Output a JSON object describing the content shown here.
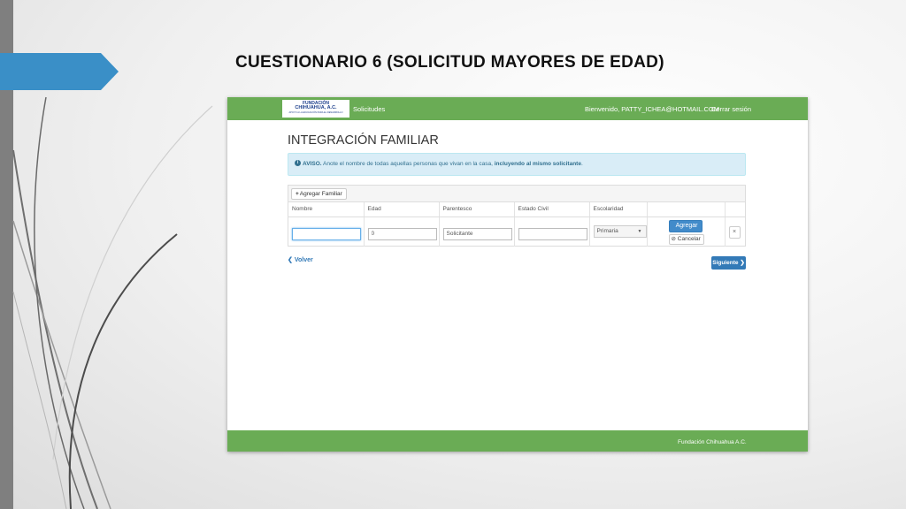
{
  "slide": {
    "title": "CUESTIONARIO 6 (SOLICITUD MAYORES DE EDAD)"
  },
  "navbar": {
    "logo_line1": "FUNDACIÓN",
    "logo_line2": "CHIHUAHUA, A.C.",
    "logo_line3": "APOYO A LA EDUCACIÓN PARA EL DESARROLLO",
    "link_solicitudes": "Solicitudes",
    "welcome": "Bienvenido, PATTY_ICHEA@HOTMAIL.COM",
    "logout": "Cerrar sesión"
  },
  "page": {
    "title": "INTEGRACIÓN FAMILIAR",
    "alert_label": "AVISO.",
    "alert_text": " Anote el nombre de todas aquellas personas que vivan en la casa, ",
    "alert_bold": "incluyendo al mismo solicitante",
    "alert_end": "."
  },
  "table": {
    "add_button": "Agregar Familiar",
    "headers": [
      "Nombre",
      "Edad",
      "Parentesco",
      "Estado Civil",
      "Escolaridad"
    ],
    "row": {
      "nombre": "",
      "edad": "0",
      "parentesco": "Solicitante",
      "estado_civil": "",
      "escolaridad": "Primaria"
    },
    "agregar_label": "Agregar",
    "cancelar_label": "Cancelar",
    "remove_label": "×"
  },
  "nav": {
    "back": "Volver",
    "next": "Siguiente"
  },
  "footer": {
    "text": "Fundación Chihuahua A.C."
  },
  "colors": {
    "navbar": "#6aac55",
    "accent": "#3a8fc7",
    "primary_button": "#428bca"
  }
}
